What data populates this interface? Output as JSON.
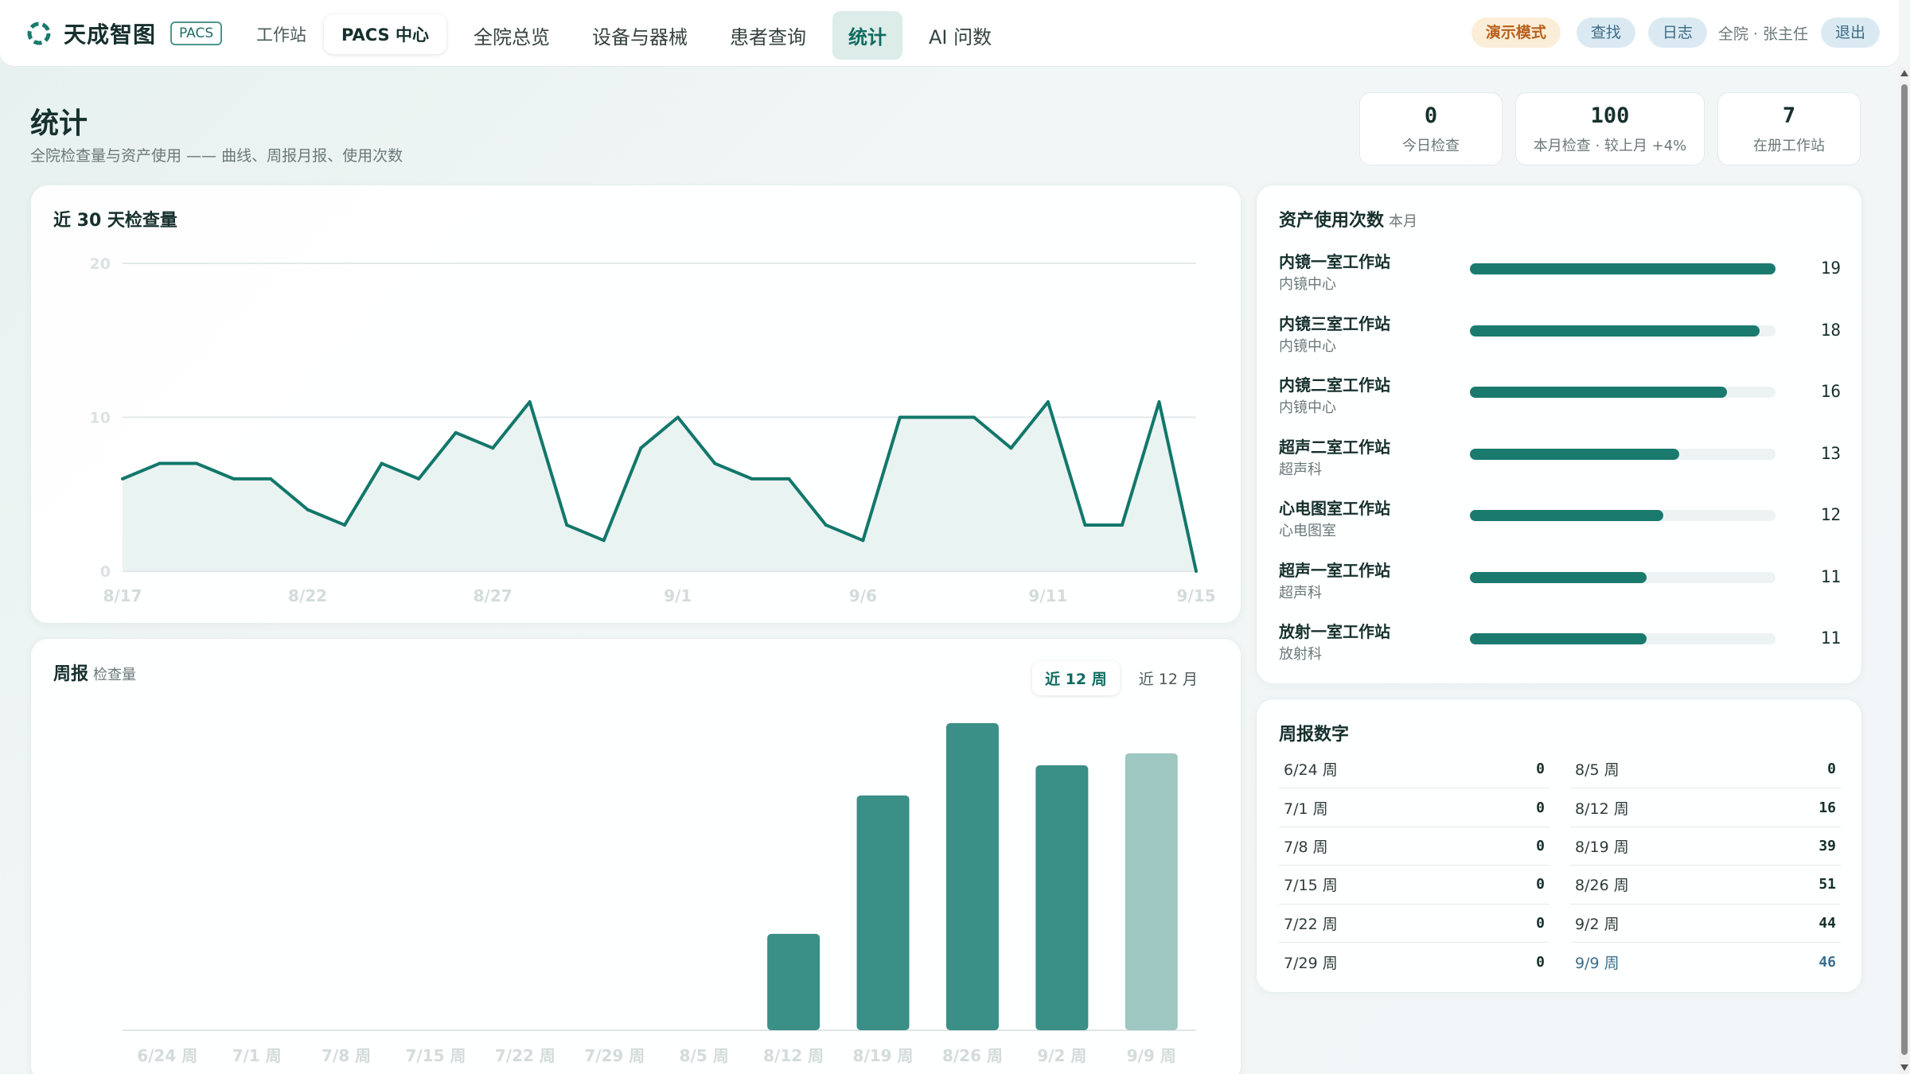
{
  "brand": {
    "name": "天成智图",
    "tag": "PACS"
  },
  "mode_tabs": [
    {
      "label": "工作站",
      "active": false
    },
    {
      "label": "PACS 中心",
      "active": true
    }
  ],
  "nav": [
    {
      "label": "全院总览",
      "active": false
    },
    {
      "label": "设备与器械",
      "active": false
    },
    {
      "label": "患者查询",
      "active": false
    },
    {
      "label": "统计",
      "active": true
    },
    {
      "label": "AI 问数",
      "active": false
    }
  ],
  "top_right": {
    "demo_mode": "演示模式",
    "search": "查找",
    "log": "日志",
    "user": "全院 · 张主任",
    "logout": "退出"
  },
  "page": {
    "title": "统计",
    "subtitle": "全院检查量与资产使用 —— 曲线、周报月报、使用次数"
  },
  "kpis": [
    {
      "value": "0",
      "label": "今日检查"
    },
    {
      "value": "100",
      "label": "本月检查 · 较上月 +4%"
    },
    {
      "value": "7",
      "label": "在册工作站"
    }
  ],
  "colors": {
    "accent": "#0f6b60",
    "line": "#12776b",
    "bar": "#3a8f86",
    "bar_current": "#9ec7c2",
    "demo_badge": "#b8601c"
  },
  "line_chart": {
    "title": "近 30 天检查量",
    "chart_data": {
      "type": "line",
      "x": [
        "8/17",
        "8/18",
        "8/19",
        "8/20",
        "8/21",
        "8/22",
        "8/23",
        "8/24",
        "8/25",
        "8/26",
        "8/27",
        "8/28",
        "8/29",
        "8/30",
        "8/31",
        "9/1",
        "9/2",
        "9/3",
        "9/4",
        "9/5",
        "9/6",
        "9/7",
        "9/8",
        "9/9",
        "9/10",
        "9/11",
        "9/12",
        "9/13",
        "9/14",
        "9/15"
      ],
      "series": [
        {
          "values": [
            6,
            7,
            7,
            6,
            6,
            4,
            3,
            7,
            6,
            9,
            8,
            11,
            3,
            2,
            8,
            10,
            7,
            6,
            6,
            3,
            2,
            10,
            10,
            10,
            8,
            11,
            3,
            3,
            11,
            0
          ]
        }
      ],
      "x_tick_labels": [
        "8/17",
        "8/22",
        "8/27",
        "9/1",
        "9/6",
        "9/11",
        "9/15"
      ],
      "y_ticks": [
        0,
        10,
        20
      ],
      "ylim": [
        0,
        20
      ],
      "grid": true
    }
  },
  "bar_chart": {
    "title": "周报",
    "subtitle": "检查量",
    "range_tabs": [
      {
        "label": "近 12 周",
        "active": true
      },
      {
        "label": "近 12 月",
        "active": false
      }
    ],
    "chart_data": {
      "type": "bar",
      "categories": [
        "6/24 周",
        "7/1 周",
        "7/8 周",
        "7/15 周",
        "7/22 周",
        "7/29 周",
        "8/5 周",
        "8/12 周",
        "8/19 周",
        "8/26 周",
        "9/2 周",
        "9/9 周"
      ],
      "values": [
        0,
        0,
        0,
        0,
        0,
        0,
        0,
        16,
        39,
        51,
        44,
        46
      ],
      "ylim": [
        0,
        51
      ],
      "highlight_last": true
    }
  },
  "assets": {
    "title": "资产使用次数",
    "subtitle": "本月",
    "max": 19,
    "items": [
      {
        "name": "内镜一室工作站",
        "dept": "内镜中心",
        "count": 19
      },
      {
        "name": "内镜三室工作站",
        "dept": "内镜中心",
        "count": 18
      },
      {
        "name": "内镜二室工作站",
        "dept": "内镜中心",
        "count": 16
      },
      {
        "name": "超声二室工作站",
        "dept": "超声科",
        "count": 13
      },
      {
        "name": "心电图室工作站",
        "dept": "心电图室",
        "count": 12
      },
      {
        "name": "超声一室工作站",
        "dept": "超声科",
        "count": 11
      },
      {
        "name": "放射一室工作站",
        "dept": "放射科",
        "count": 11
      }
    ]
  },
  "weekly_numbers": {
    "title": "周报数字",
    "left": [
      {
        "label": "6/24 周",
        "value": "0"
      },
      {
        "label": "7/1 周",
        "value": "0"
      },
      {
        "label": "7/8 周",
        "value": "0"
      },
      {
        "label": "7/15 周",
        "value": "0"
      },
      {
        "label": "7/22 周",
        "value": "0"
      },
      {
        "label": "7/29 周",
        "value": "0"
      }
    ],
    "right": [
      {
        "label": "8/5 周",
        "value": "0"
      },
      {
        "label": "8/12 周",
        "value": "16"
      },
      {
        "label": "8/19 周",
        "value": "39"
      },
      {
        "label": "8/26 周",
        "value": "51"
      },
      {
        "label": "9/2 周",
        "value": "44"
      },
      {
        "label": "9/9 周",
        "value": "46",
        "current": true
      }
    ]
  }
}
